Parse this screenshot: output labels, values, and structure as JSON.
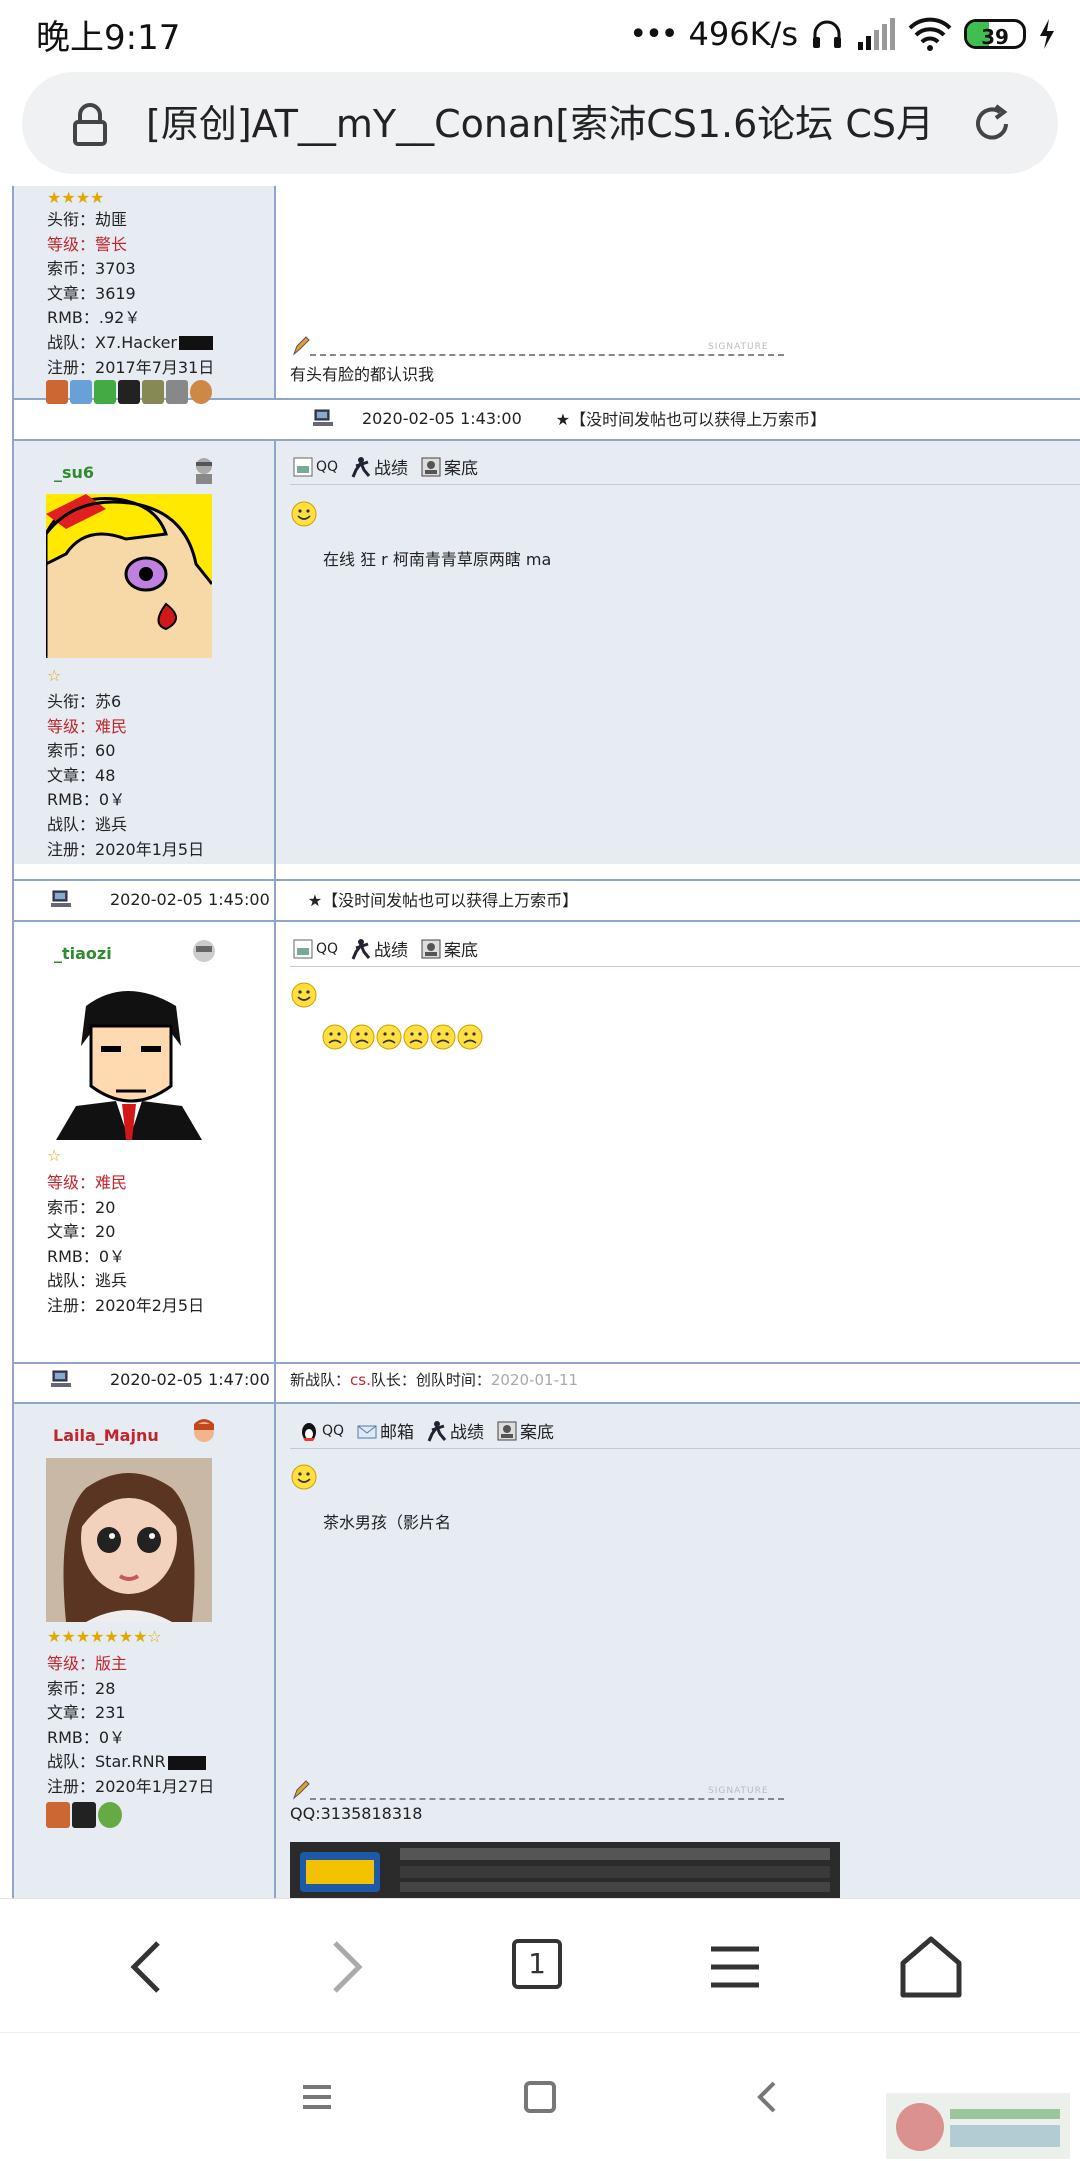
{
  "status_bar": {
    "time": "晚上9:17",
    "speed": "496K/s",
    "battery": "39"
  },
  "address_bar": {
    "url": "[原创]AT__mY__Conan[索沛CS1.6论坛 CS月"
  },
  "post1": {
    "info": {
      "title_label": "头衔：",
      "title_value": "劫匪",
      "level_label": "等级：",
      "level_value": "警长",
      "coins_label": "索币：",
      "coins_value": "3703",
      "articles_label": "文章：",
      "articles_value": "3619",
      "rmb_label": "RMB：",
      "rmb_value": ".92￥",
      "team_label": "战队：",
      "team_value": "X7.Hacker",
      "reg_label": "注册：",
      "reg_value": "2017年7月31日"
    },
    "signature_label": "SIGNATURE",
    "signature_text": "有头有脸的都认识我"
  },
  "post2": {
    "timestamp": "2020-02-05 1:43:00",
    "notice": "★【没时间发帖也可以获得上万索币】",
    "username": "_su6",
    "toolbar": {
      "qq": "QQ",
      "stats": "战绩",
      "record": "案底"
    },
    "text": "在线 狂 r 柯南青青草原两瞎 ma",
    "info": {
      "title_label": "头衔：",
      "title_value": "苏6",
      "level_label": "等级：",
      "level_value": "难民",
      "coins_label": "索币：",
      "coins_value": "60",
      "articles_label": "文章：",
      "articles_value": "48",
      "rmb_label": "RMB：",
      "rmb_value": "0￥",
      "team_label": "战队：",
      "team_value": "逃兵",
      "reg_label": "注册：",
      "reg_value": "2020年1月5日"
    }
  },
  "post3": {
    "timestamp": "2020-02-05 1:45:00",
    "notice": "★【没时间发帖也可以获得上万索币】",
    "username": "_tiaozi",
    "toolbar": {
      "qq": "QQ",
      "stats": "战绩",
      "record": "案底"
    },
    "info": {
      "level_label": "等级：",
      "level_value": "难民",
      "coins_label": "索币：",
      "coins_value": "20",
      "articles_label": "文章：",
      "articles_value": "20",
      "rmb_label": "RMB：",
      "rmb_value": "0￥",
      "team_label": "战队：",
      "team_value": "逃兵",
      "reg_label": "注册：",
      "reg_value": "2020年2月5日"
    }
  },
  "post4": {
    "timestamp": "2020-02-05 1:47:00",
    "notice_prefix": "新战队：",
    "notice_team": "cs.",
    "notice_leader": " 队长：",
    "notice_created": " 创队时间：",
    "notice_date": "2020-01-11",
    "username": "Laila_Majnu",
    "toolbar": {
      "qq": "QQ",
      "mail": "邮箱",
      "stats": "战绩",
      "record": "案底"
    },
    "text": "茶水男孩（影片名",
    "info": {
      "level_label": "等级：",
      "level_value": "版主",
      "coins_label": "索币：",
      "coins_value": "28",
      "articles_label": "文章：",
      "articles_value": "231",
      "rmb_label": "RMB：",
      "rmb_value": "0￥",
      "team_label": "战队：",
      "team_value": "Star.RNR",
      "reg_label": "注册：",
      "reg_value": "2020年1月27日"
    },
    "signature_label": "SIGNATURE",
    "signature_text": "QQ:3135818318"
  },
  "browser_nav": {
    "tab_count": "1"
  },
  "colors": {
    "accent_red": "#c0272d",
    "name_green": "#2e8b2e",
    "grid_blue": "#8fa6cc",
    "panel_bg": "#e7ecf3"
  }
}
